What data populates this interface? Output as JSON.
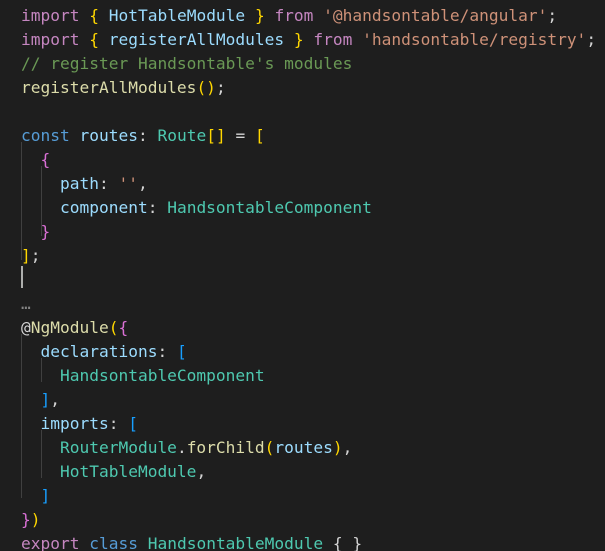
{
  "editor": {
    "lines": [
      {
        "tokens": [
          {
            "t": "import",
            "c": "import"
          },
          {
            "t": " "
          },
          {
            "t": "{",
            "c": "brace"
          },
          {
            "t": " "
          },
          {
            "t": "HotTableModule",
            "c": "ident"
          },
          {
            "t": " "
          },
          {
            "t": "}",
            "c": "brace"
          },
          {
            "t": " "
          },
          {
            "t": "from",
            "c": "import"
          },
          {
            "t": " "
          },
          {
            "t": "'@handsontable/angular'",
            "c": "string"
          },
          {
            "t": ";",
            "c": "plain"
          }
        ]
      },
      {
        "tokens": [
          {
            "t": "import",
            "c": "import"
          },
          {
            "t": " "
          },
          {
            "t": "{",
            "c": "brace"
          },
          {
            "t": " "
          },
          {
            "t": "registerAllModules",
            "c": "ident"
          },
          {
            "t": " "
          },
          {
            "t": "}",
            "c": "brace"
          },
          {
            "t": " "
          },
          {
            "t": "from",
            "c": "import"
          },
          {
            "t": " "
          },
          {
            "t": "'handsontable/registry'",
            "c": "string"
          },
          {
            "t": ";",
            "c": "plain"
          }
        ]
      },
      {
        "tokens": [
          {
            "t": "// register Handsontable's modules",
            "c": "comment"
          }
        ]
      },
      {
        "tokens": [
          {
            "t": "registerAllModules",
            "c": "func"
          },
          {
            "t": "()",
            "c": "brace"
          },
          {
            "t": ";",
            "c": "plain"
          }
        ]
      },
      {
        "tokens": []
      },
      {
        "tokens": [
          {
            "t": "const",
            "c": "keyword"
          },
          {
            "t": " "
          },
          {
            "t": "routes",
            "c": "ident"
          },
          {
            "t": ": ",
            "c": "plain"
          },
          {
            "t": "Route",
            "c": "class"
          },
          {
            "t": "[]",
            "c": "brace"
          },
          {
            "t": " = ",
            "c": "plain"
          },
          {
            "t": "[",
            "c": "brace"
          }
        ]
      },
      {
        "tokens": [
          {
            "t": "  "
          },
          {
            "t": "{",
            "c": "bracket2"
          }
        ]
      },
      {
        "tokens": [
          {
            "t": "    "
          },
          {
            "t": "path",
            "c": "ident"
          },
          {
            "t": ": ",
            "c": "plain"
          },
          {
            "t": "''",
            "c": "string"
          },
          {
            "t": ",",
            "c": "plain"
          }
        ]
      },
      {
        "tokens": [
          {
            "t": "    "
          },
          {
            "t": "component",
            "c": "ident"
          },
          {
            "t": ": ",
            "c": "plain"
          },
          {
            "t": "HandsontableComponent",
            "c": "class"
          }
        ]
      },
      {
        "tokens": [
          {
            "t": "  "
          },
          {
            "t": "}",
            "c": "bracket2"
          }
        ]
      },
      {
        "tokens": [
          {
            "t": "]",
            "c": "brace"
          },
          {
            "t": ";",
            "c": "plain"
          }
        ]
      },
      {
        "tokens": []
      },
      {
        "tokens": [
          {
            "t": "…",
            "c": "ellipsis"
          }
        ]
      },
      {
        "tokens": [
          {
            "t": "@",
            "c": "plain"
          },
          {
            "t": "NgModule",
            "c": "decorator"
          },
          {
            "t": "(",
            "c": "brace"
          },
          {
            "t": "{",
            "c": "bracket2"
          }
        ]
      },
      {
        "tokens": [
          {
            "t": "  "
          },
          {
            "t": "declarations",
            "c": "ident"
          },
          {
            "t": ": ",
            "c": "plain"
          },
          {
            "t": "[",
            "c": "bracket3"
          }
        ]
      },
      {
        "tokens": [
          {
            "t": "    "
          },
          {
            "t": "HandsontableComponent",
            "c": "class"
          }
        ]
      },
      {
        "tokens": [
          {
            "t": "  "
          },
          {
            "t": "]",
            "c": "bracket3"
          },
          {
            "t": ",",
            "c": "plain"
          }
        ]
      },
      {
        "tokens": [
          {
            "t": "  "
          },
          {
            "t": "imports",
            "c": "ident"
          },
          {
            "t": ": ",
            "c": "plain"
          },
          {
            "t": "[",
            "c": "bracket3"
          }
        ]
      },
      {
        "tokens": [
          {
            "t": "    "
          },
          {
            "t": "RouterModule",
            "c": "class"
          },
          {
            "t": ".",
            "c": "plain"
          },
          {
            "t": "forChild",
            "c": "func"
          },
          {
            "t": "(",
            "c": "brace"
          },
          {
            "t": "routes",
            "c": "ident"
          },
          {
            "t": ")",
            "c": "brace"
          },
          {
            "t": ",",
            "c": "plain"
          }
        ]
      },
      {
        "tokens": [
          {
            "t": "    "
          },
          {
            "t": "HotTableModule",
            "c": "class"
          },
          {
            "t": ",",
            "c": "plain"
          }
        ]
      },
      {
        "tokens": [
          {
            "t": "  "
          },
          {
            "t": "]",
            "c": "bracket3"
          }
        ]
      },
      {
        "tokens": [
          {
            "t": "}",
            "c": "bracket2"
          },
          {
            "t": ")",
            "c": "brace"
          }
        ]
      },
      {
        "tokens": [
          {
            "t": "export",
            "c": "import"
          },
          {
            "t": " "
          },
          {
            "t": "class",
            "c": "keyword"
          },
          {
            "t": " "
          },
          {
            "t": "HandsontableModule",
            "c": "class"
          },
          {
            "t": " "
          },
          {
            "t": "{ }",
            "c": "plain"
          }
        ]
      }
    ]
  }
}
